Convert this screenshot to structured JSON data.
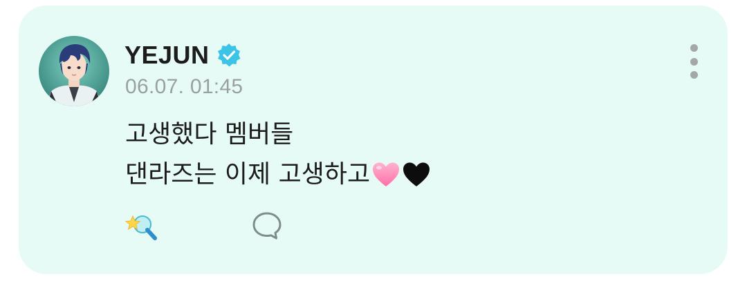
{
  "post": {
    "author": "YEJUN",
    "verified": true,
    "timestamp": "06.07. 01:45",
    "body_lines": [
      "고생했다 멤버들",
      "댄라즈는 이제 고생하고"
    ],
    "emojis": [
      "pink-heart",
      "black-heart"
    ]
  },
  "actions": {
    "react_icon": "star-magnifier-icon",
    "comment_icon": "speech-bubble-icon"
  },
  "colors": {
    "card_background": "#e6fbf6",
    "verified_badge": "#3cc4e6",
    "timestamp": "#9aa0a0",
    "text": "#1c1c1c"
  }
}
